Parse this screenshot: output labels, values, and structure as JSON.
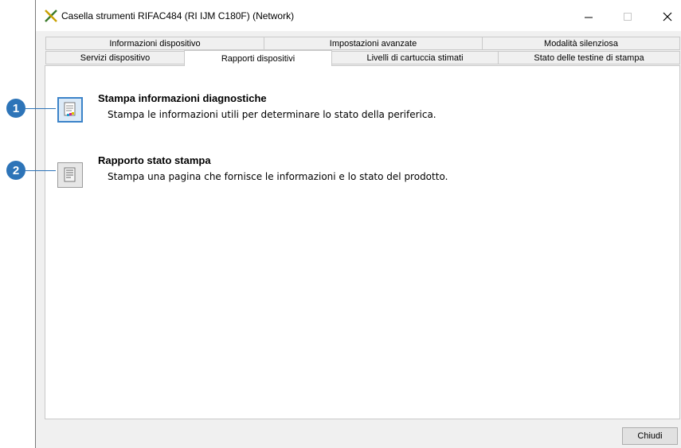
{
  "window": {
    "title": "Casella strumenti RIFAC484 (RI IJM C180F) (Network)",
    "controls": {
      "minimize": "—",
      "maximize": "☐",
      "close": "✕"
    }
  },
  "tabs": {
    "row1": [
      "Informazioni dispositivo",
      "Impostazioni avanzate",
      "Modalità silenziosa"
    ],
    "row2": [
      "Servizi dispositivo",
      "Rapporti dispositivi",
      "Livelli di cartuccia stimati",
      "Stato delle testine di stampa"
    ],
    "active": "Rapporti dispositivi"
  },
  "items": [
    {
      "title": "Stampa informazioni diagnostiche",
      "description": "Stampa le informazioni  utili per determinare lo stato della periferica."
    },
    {
      "title": "Rapporto stato stampa",
      "description": "Stampa una pagina che fornisce le informazioni e lo stato del prodotto."
    }
  ],
  "callouts": [
    "1",
    "2"
  ],
  "footer": {
    "close_label": "Chiudi"
  },
  "colors": {
    "accent": "#2d74b8",
    "selection": "#3b83c9"
  }
}
